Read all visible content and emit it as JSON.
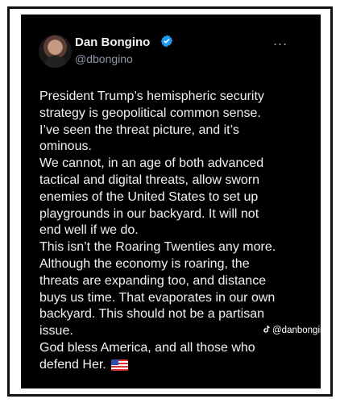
{
  "post": {
    "author_name": "Dan Bongino",
    "handle": "@dbongino",
    "more_label": "...",
    "text_lines": [
      "President Trump’s hemispheric security",
      "strategy is geopolitical common sense.",
      "I’ve seen the threat picture, and it’s",
      "ominous.",
      "We cannot, in an age of both advanced",
      "tactical and digital threats, allow sworn",
      "enemies of the United States to set up",
      "playgrounds in our backyard. It will not",
      "end well if we do.",
      "This isn’t the Roaring Twenties any more.",
      "Although the economy is roaring, the",
      "threats are expanding too, and distance",
      "buys us time. That evaporates in our own",
      "backyard. This should not be a partisan",
      "issue.",
      "God bless America, and all those who",
      "defend Her."
    ]
  },
  "watermark": {
    "text": "@danbongino",
    "icon": "tiktok-icon"
  },
  "icons": {
    "avatar": "avatar",
    "verified": "verified-badge-icon",
    "more": "more-options-icon",
    "flag": "us-flag-icon"
  },
  "colors": {
    "background": "#000000",
    "text": "#e7e9ea",
    "secondary_text": "#8b98a5",
    "verified": "#1d9bf0"
  }
}
